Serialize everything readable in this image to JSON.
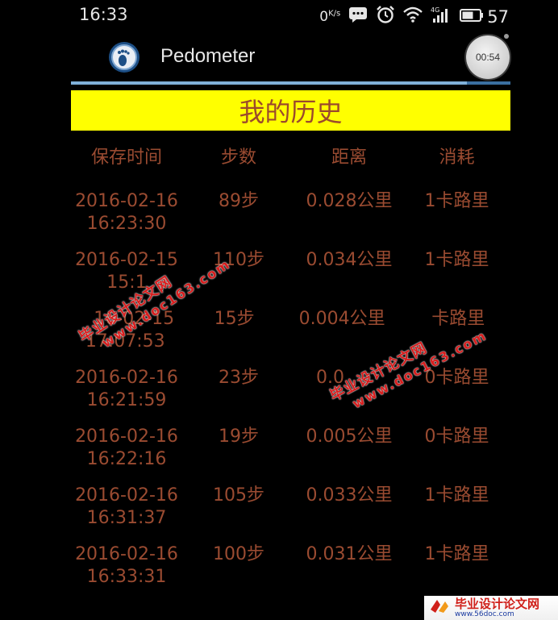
{
  "status_bar": {
    "time": "16:33",
    "net_speed": "0",
    "net_speed_unit": "K/s",
    "signal_label": "4G",
    "battery_level": "57",
    "icons": [
      "message-icon",
      "alarm-icon",
      "wifi-icon",
      "cell-signal-icon",
      "battery-icon"
    ]
  },
  "app_bar": {
    "title": "Pedometer",
    "app_icon": "footprint-icon",
    "timer": "00:54"
  },
  "page": {
    "heading": "我的历史"
  },
  "history_table": {
    "columns": [
      "保存时间",
      "步数",
      "距离",
      "消耗"
    ],
    "rows": [
      {
        "date": "2016-02-16",
        "time": "16:23:30",
        "steps": "89步",
        "distance": "0.028公里",
        "calories": "1卡路里"
      },
      {
        "date": "2016-02-15",
        "time": "15:1",
        "steps": "110步",
        "distance": "0.034公里",
        "calories": "1卡路里"
      },
      {
        "date": "16-02-15",
        "time": "17:07:53",
        "steps": "15步",
        "distance": "0.004公里",
        "calories": "卡路里"
      },
      {
        "date": "2016-02-16",
        "time": "16:21:59",
        "steps": "23步",
        "distance": "0.0",
        "calories": "0卡路里"
      },
      {
        "date": "2016-02-16",
        "time": "16:22:16",
        "steps": "19步",
        "distance": "0.005公里",
        "calories": "0卡路里"
      },
      {
        "date": "2016-02-16",
        "time": "16:31:37",
        "steps": "105步",
        "distance": "0.033公里",
        "calories": "1卡路里"
      },
      {
        "date": "2016-02-16",
        "time": "16:33:31",
        "steps": "100步",
        "distance": "0.031公里",
        "calories": "1卡路里"
      }
    ]
  },
  "watermarks": [
    {
      "line1": "毕业设计论文网",
      "line2": "www.doc163.com"
    },
    {
      "line1": "毕业设计论文网",
      "line2": "www.doc163.com"
    }
  ],
  "brand": {
    "name": "毕业设计论文网",
    "url": "www.56doc.com"
  },
  "colors": {
    "banner_bg": "#ffff00",
    "text_accent": "#9a4b31",
    "watermark": "#d81d1d"
  }
}
